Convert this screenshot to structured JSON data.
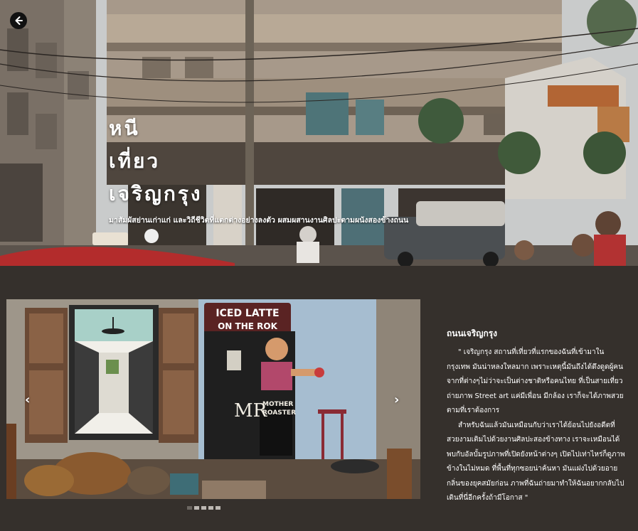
{
  "hero": {
    "title_lines": [
      "หนี",
      "เที่ยว",
      "เจริญกรุง"
    ],
    "subtitle": "มาสัมผัสย่านเก่าแก่ และวิถีชีวิตที่แตกต่างอย่างลงตัว ผสมผสานงานศิลปะตามผนังสองข้างถนน",
    "back_icon": "arrow-left-icon"
  },
  "carousel": {
    "prev_symbol": "‹",
    "next_symbol": "›",
    "slide_count": 5,
    "active_index": 0,
    "mural_text": {
      "sign_line1": "ICED LATTE",
      "sign_line2": "ON THE ROK",
      "monogram": "MR",
      "label_line1": "MOTHER",
      "label_line2": "ROASTER"
    }
  },
  "article": {
    "heading": "ถนนเจริญกรุง",
    "paragraphs": [
      "\" เจริญกรุง สถานที่เที่ยวที่แรกของฉันที่เข้ามาในกรุงเทพ มันน่าหลงใหลมาก เพราะเหตุนี้มันถึงได้ดึงดูดผู้คนจากที่ต่างๆไม่ว่าจะเป็นต่างชาติหรือคนไทย ที่เป็นสายเที่ยว ถ่ายภาพ Street art แค่มีเพื่อน มีกล้อง เราก็จะได้ภาพสวยตามที่เราต้องการ",
      "สำหรับฉันแล้วมันเหมือนกับว่าเราได้ย้อนไปยังอดีตที่สวยงามเติมไปด้วยงานศิลปะสองข้างทาง เราจะเหมือนได้พบกับอัลบั้มรูปภาพที่เปิดยังหน้าต่างๆ เปิดไปเท่าไหร่ก็ดูภาพข้างในไม่หมด ที่พื้นที่ทุกซอยน่าค้นหา มันแฝงไปด้วยอายกลิ่นของยุคสมัยก่อน ภาพที่ฉันถ่ายมาทำให้ฉันอยากกลับไปเดินที่นี่อีกครั้งถ้ามีโอกาส \""
    ]
  },
  "colors": {
    "page_bg": "#35302c",
    "text": "#ffffff",
    "indicator_active": "#6b6661",
    "indicator_inactive": "#bdb8b3"
  }
}
